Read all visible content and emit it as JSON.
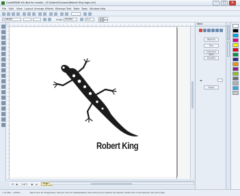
{
  "window": {
    "title": "CorelDRAW X4 (Not for resale) - [F:\\Gabriel\\Gusano\\Robert King logo.cdr]",
    "min_glyph": "–",
    "max_glyph": "□",
    "close_glyph": "×"
  },
  "menu": {
    "items": [
      "File",
      "Edit",
      "View",
      "Layout",
      "Arrange",
      "Effects",
      "Bitmaps",
      "Text",
      "Table",
      "Tools",
      "Window",
      "Help"
    ]
  },
  "property_bar": {
    "paper_size": "Custom",
    "units_label": "Units:",
    "units_value": "inches",
    "nudge_value": "0.1\"",
    "dup_x": "0.25\"",
    "dup_y": "0.25\""
  },
  "docker": {
    "title": "Weld",
    "buttons": [
      "Weld To",
      "Trim",
      "Intersect With",
      "Simplify",
      "Front minus back",
      "Back minus front"
    ],
    "apply_label": "Apply"
  },
  "page_nav": {
    "position": "1 of 1",
    "tab_label": "Page 1"
  },
  "artwork": {
    "brand_name": "Robert King",
    "mark": "gecko-logo"
  },
  "status": {
    "coords": "( 12.384 , -0.640 )",
    "hint": "Next click for Drag/Scale; Second click for Rotate/Skew; Dbl-clicking tool selects all objects; Shift+click multi-selects; Alt+click digs"
  },
  "colors": {
    "accent": "#2f7c2d",
    "logo": "#1b1b1b",
    "palette": [
      "#ffffff",
      "#000000",
      "#00a0e3",
      "#e2007a",
      "#ffed00",
      "#e30613",
      "#009640",
      "#312783",
      "#f39200",
      "#951b81",
      "#95c11f",
      "#6f6f6e",
      "#b2b2b2",
      "#36a9e1",
      "#c6c6c5"
    ]
  }
}
